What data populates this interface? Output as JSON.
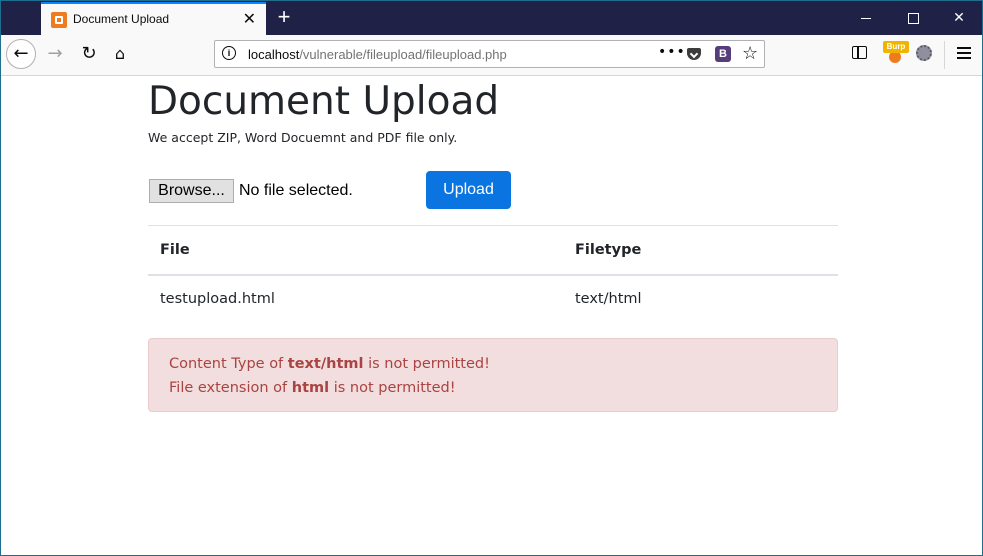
{
  "browser": {
    "tab_title": "Document Upload",
    "tab_close": "✕",
    "new_tab": "+",
    "url_host": "localhost",
    "url_path": "/vulnerable/fileupload/fileupload.php",
    "url_dots": "•••",
    "bootstrap_badge": "B",
    "burp_label": "Burp"
  },
  "page": {
    "heading": "Document Upload",
    "subtitle": "We accept ZIP, Word Docuemnt and PDF file only.",
    "browse_label": "Browse...",
    "file_status": "No file selected.",
    "upload_label": "Upload"
  },
  "table": {
    "headers": [
      "File",
      "Filetype"
    ],
    "rows": [
      [
        "testupload.html",
        "text/html"
      ]
    ]
  },
  "alert": {
    "line1_prefix": "Content Type of ",
    "line1_bold": "text/html",
    "line1_suffix": " is not permitted!",
    "line2_prefix": "File extension of ",
    "line2_bold": "html",
    "line2_suffix": " is not permitted!"
  },
  "colors": {
    "titlebar": "#1f2147",
    "primary_button": "#0a74e0",
    "alert_bg": "#f2dede",
    "alert_text": "#a94442"
  }
}
